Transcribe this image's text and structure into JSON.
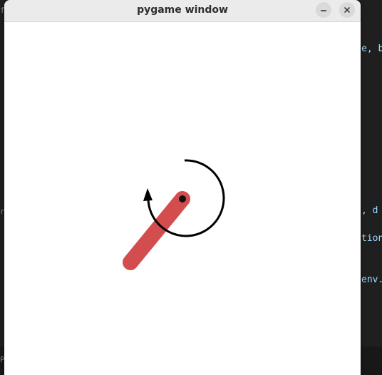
{
  "window": {
    "title": "pygame window",
    "controls": {
      "minimize_icon": "minimize-icon",
      "close_icon": "close-icon"
    }
  },
  "background_editor": {
    "snippets": [
      "e, b",
      ", d",
      "tion",
      "env."
    ],
    "gutter_chars": [
      "f",
      "r",
      "P"
    ]
  },
  "pendulum": {
    "rod_color": "#d34d4f",
    "pivot_color": "#111111",
    "torque_arrow_color": "#000000",
    "torque_direction": "counterclockwise"
  }
}
